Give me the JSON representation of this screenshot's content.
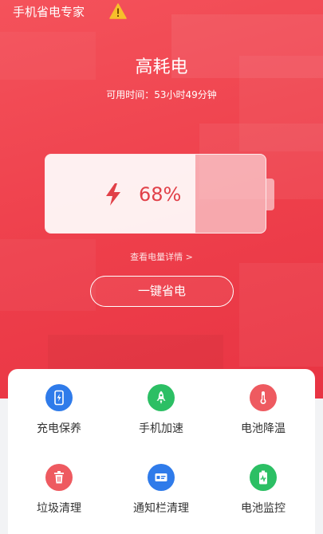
{
  "header": {
    "app_title": "手机省电专家",
    "warning_icon": "warning-icon"
  },
  "status": {
    "title": "高耗电",
    "time_label": "可用时间：",
    "time_value": "53小时49分钟"
  },
  "battery": {
    "level": 68,
    "percent_label": "68%"
  },
  "detail_link": "查看电量详情 >",
  "save_button": "一键省电",
  "colors": {
    "hero": "#ee3f4b",
    "blue": "#2f7bea",
    "green": "#2cbf64",
    "red": "#ee5a60"
  },
  "tools": [
    {
      "label": "充电保养",
      "icon": "phone-charging-icon",
      "color": "#2f7bea"
    },
    {
      "label": "手机加速",
      "icon": "rocket-icon",
      "color": "#2cbf64"
    },
    {
      "label": "电池降温",
      "icon": "thermometer-icon",
      "color": "#ee5a60"
    },
    {
      "label": "垃圾清理",
      "icon": "trash-icon",
      "color": "#ee5a60"
    },
    {
      "label": "通知栏清理",
      "icon": "notification-card-icon",
      "color": "#2f7bea"
    },
    {
      "label": "电池监控",
      "icon": "battery-monitor-icon",
      "color": "#2cbf64"
    }
  ]
}
